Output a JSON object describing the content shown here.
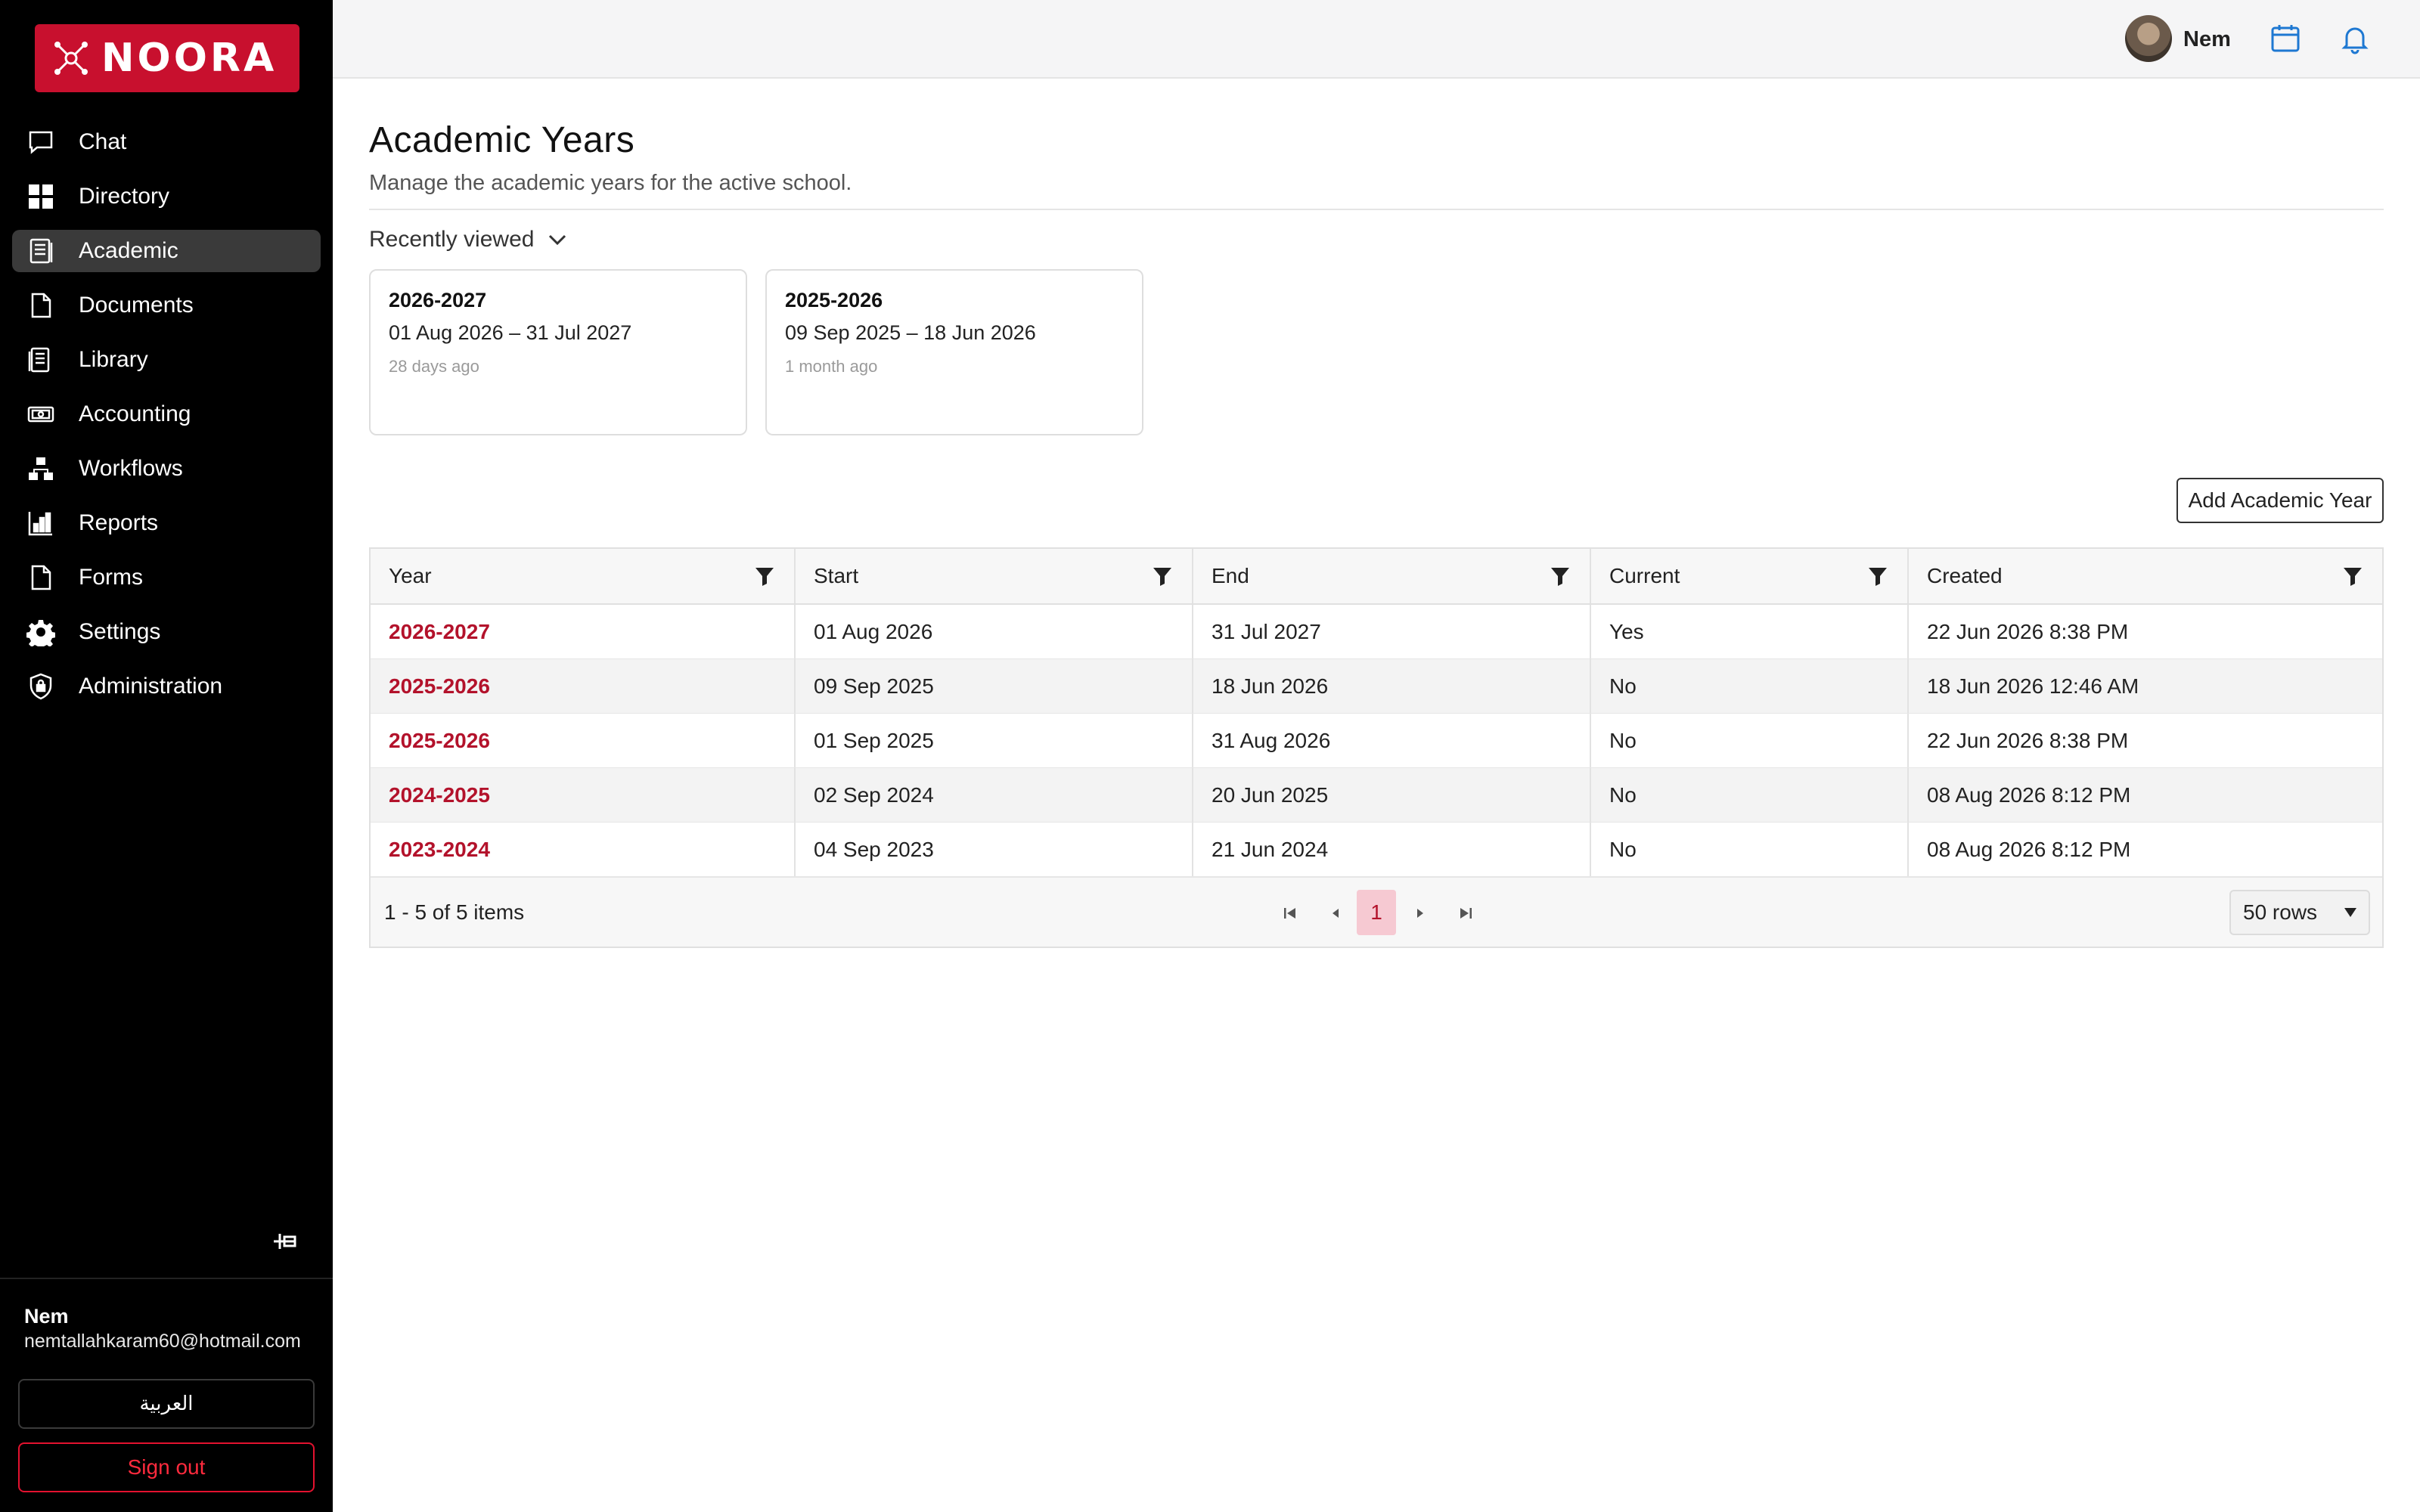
{
  "brand": {
    "name": "NOORA",
    "color": "#c8102e"
  },
  "sidebar": {
    "items": [
      {
        "label": "Chat",
        "icon": "chat-icon"
      },
      {
        "label": "Directory",
        "icon": "grid-icon"
      },
      {
        "label": "Academic",
        "icon": "book-icon",
        "active": true
      },
      {
        "label": "Documents",
        "icon": "document-icon"
      },
      {
        "label": "Library",
        "icon": "library-icon"
      },
      {
        "label": "Accounting",
        "icon": "money-icon"
      },
      {
        "label": "Workflows",
        "icon": "workflow-icon"
      },
      {
        "label": "Reports",
        "icon": "reports-icon"
      },
      {
        "label": "Forms",
        "icon": "form-icon"
      },
      {
        "label": "Settings",
        "icon": "gear-icon"
      },
      {
        "label": "Administration",
        "icon": "shield-icon"
      }
    ],
    "user": {
      "name": "Nem",
      "email": "nemtallahkaram60@hotmail.com"
    },
    "language_button": "العربية",
    "signout_button": "Sign out"
  },
  "topbar": {
    "user_name": "Nem"
  },
  "page": {
    "title": "Academic Years",
    "subtitle": "Manage the academic years for the active school.",
    "recently_viewed_label": "Recently viewed",
    "recent_cards": [
      {
        "title": "2026-2027",
        "range": "01 Aug 2026 – 31 Jul 2027",
        "ago": "28 days ago"
      },
      {
        "title": "2025-2026",
        "range": "09 Sep 2025 – 18 Jun 2026",
        "ago": "1 month ago"
      }
    ],
    "add_button": "Add Academic Year"
  },
  "table": {
    "columns": [
      "Year",
      "Start",
      "End",
      "Current",
      "Created"
    ],
    "rows": [
      [
        "2026-2027",
        "01 Aug 2026",
        "31 Jul 2027",
        "Yes",
        "22 Jun 2026 8:38 PM"
      ],
      [
        "2025-2026",
        "09 Sep 2025",
        "18 Jun 2026",
        "No",
        "18 Jun 2026 12:46 AM"
      ],
      [
        "2025-2026",
        "01 Sep 2025",
        "31 Aug 2026",
        "No",
        "22 Jun 2026 8:38 PM"
      ],
      [
        "2024-2025",
        "02 Sep 2024",
        "20 Jun 2025",
        "No",
        "08 Aug 2026 8:12 PM"
      ],
      [
        "2023-2024",
        "04 Sep 2023",
        "21 Jun 2024",
        "No",
        "08 Aug 2026 8:12 PM"
      ]
    ],
    "pager": {
      "count": "1 - 5 of 5 items",
      "page": "1",
      "rows_per_page": "50 rows"
    }
  }
}
